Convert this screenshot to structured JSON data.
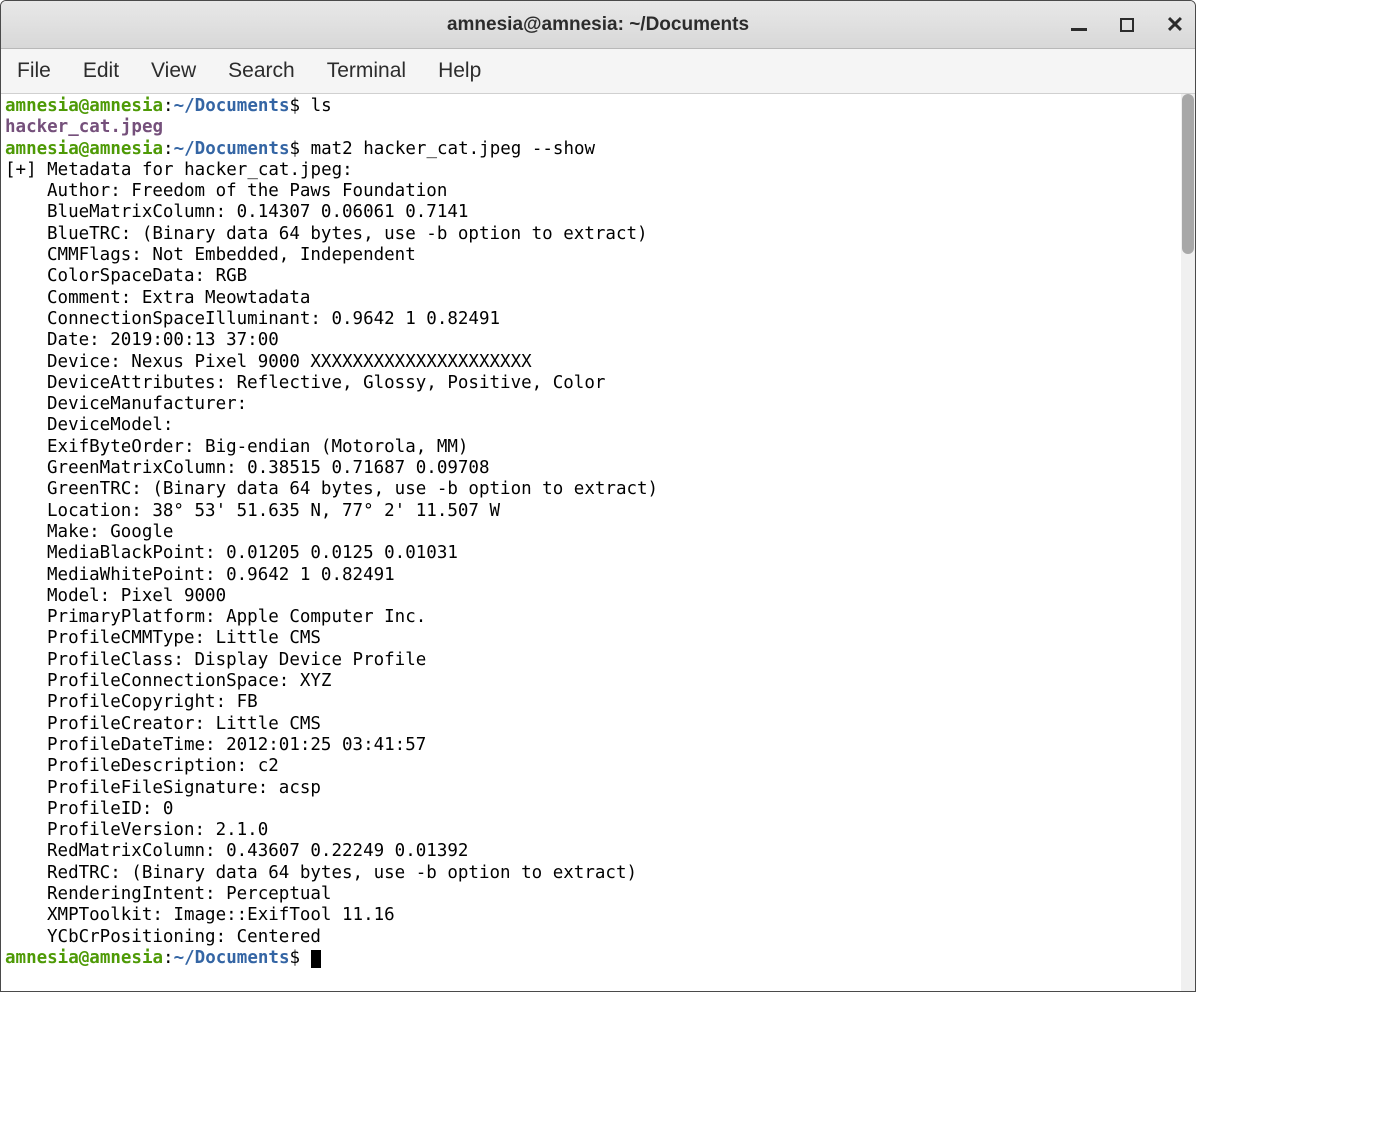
{
  "window": {
    "title": "amnesia@amnesia: ~/Documents"
  },
  "menubar": {
    "items": [
      "File",
      "Edit",
      "View",
      "Search",
      "Terminal",
      "Help"
    ]
  },
  "terminal": {
    "prompt_user": "amnesia@amnesia",
    "prompt_sep": ":",
    "prompt_path": "~/Documents",
    "prompt_end": "$",
    "cmd1": "ls",
    "ls_output": "hacker_cat.jpeg",
    "cmd2": "mat2 hacker_cat.jpeg --show",
    "metadata_header": "[+] Metadata for hacker_cat.jpeg:",
    "metadata": [
      "Author: Freedom of the Paws Foundation",
      "BlueMatrixColumn: 0.14307 0.06061 0.7141",
      "BlueTRC: (Binary data 64 bytes, use -b option to extract)",
      "CMMFlags: Not Embedded, Independent",
      "ColorSpaceData: RGB",
      "Comment: Extra Meowtadata",
      "ConnectionSpaceIlluminant: 0.9642 1 0.82491",
      "Date: 2019:00:13 37:00",
      "Device: Nexus Pixel 9000 XXXXXXXXXXXXXXXXXXXXX",
      "DeviceAttributes: Reflective, Glossy, Positive, Color",
      "DeviceManufacturer:",
      "DeviceModel:",
      "ExifByteOrder: Big-endian (Motorola, MM)",
      "GreenMatrixColumn: 0.38515 0.71687 0.09708",
      "GreenTRC: (Binary data 64 bytes, use -b option to extract)",
      "Location: 38° 53' 51.635 N, 77° 2' 11.507 W",
      "Make: Google",
      "MediaBlackPoint: 0.01205 0.0125 0.01031",
      "MediaWhitePoint: 0.9642 1 0.82491",
      "Model: Pixel 9000",
      "PrimaryPlatform: Apple Computer Inc.",
      "ProfileCMMType: Little CMS",
      "ProfileClass: Display Device Profile",
      "ProfileConnectionSpace: XYZ",
      "ProfileCopyright: FB",
      "ProfileCreator: Little CMS",
      "ProfileDateTime: 2012:01:25 03:41:57",
      "ProfileDescription: c2",
      "ProfileFileSignature: acsp",
      "ProfileID: 0",
      "ProfileVersion: 2.1.0",
      "RedMatrixColumn: 0.43607 0.22249 0.01392",
      "RedTRC: (Binary data 64 bytes, use -b option to extract)",
      "RenderingIntent: Perceptual",
      "XMPToolkit: Image::ExifTool 11.16",
      "YCbCrPositioning: Centered"
    ]
  }
}
